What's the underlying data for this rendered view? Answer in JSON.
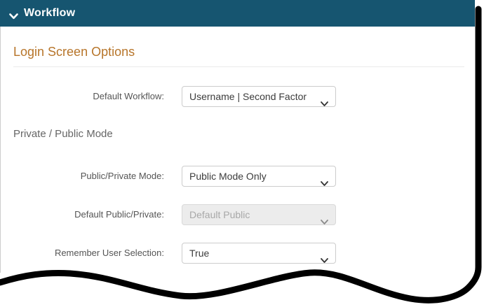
{
  "panel": {
    "header": {
      "title": "Workflow",
      "icon": "chevron-down-icon",
      "bg_color": "#165570",
      "text_color": "#ffffff"
    },
    "section": {
      "heading": "Login Screen Options",
      "heading_color": "#b7752a"
    },
    "subsection_label": "Private / Public Mode",
    "fields": {
      "default_workflow": {
        "label": "Default Workflow:",
        "value": "Username | Second Factor",
        "disabled": false
      },
      "public_private_mode": {
        "label": "Public/Private Mode:",
        "value": "Public Mode Only",
        "disabled": false
      },
      "default_public_private": {
        "label": "Default Public/Private:",
        "value": "Default Public",
        "disabled": true
      },
      "remember_user_selection": {
        "label": "Remember User Selection:",
        "value": "True",
        "disabled": false
      }
    }
  }
}
